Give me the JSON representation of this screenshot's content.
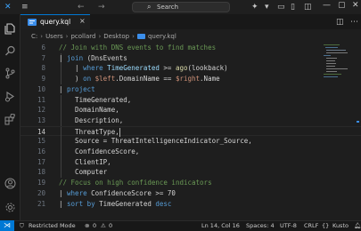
{
  "titlebar": {
    "search_label": "Search",
    "colors": {
      "accent": "#0078d4"
    }
  },
  "tab": {
    "name": "query.kql",
    "close": "×"
  },
  "breadcrumb": [
    "C:",
    "Users",
    "pcollard",
    "Desktop",
    "query.kql"
  ],
  "editor": {
    "current_line": 14,
    "lines": [
      {
        "n": "6",
        "tokens": [
          {
            "t": "// Join with DNS events to find matches",
            "c": "com"
          }
        ],
        "indent": 0
      },
      {
        "n": "7",
        "tokens": [
          {
            "t": "| ",
            "c": "pl"
          },
          {
            "t": "join",
            "c": "kw"
          },
          {
            "t": " (DnsEvents",
            "c": "pl"
          }
        ],
        "indent": 1
      },
      {
        "n": "8",
        "tokens": [
          {
            "t": "    | ",
            "c": "pl"
          },
          {
            "t": "where",
            "c": "kw"
          },
          {
            "t": " TimeGenerated ",
            "c": "id"
          },
          {
            "t": ">= ",
            "c": "pl"
          },
          {
            "t": "ago",
            "c": "fn"
          },
          {
            "t": "(lookback)",
            "c": "pl"
          }
        ],
        "indent": 1
      },
      {
        "n": "9",
        "tokens": [
          {
            "t": "    ) ",
            "c": "pl"
          },
          {
            "t": "on ",
            "c": "kw"
          },
          {
            "t": "$left",
            "c": "var"
          },
          {
            "t": ".DomainName == ",
            "c": "pl"
          },
          {
            "t": "$right",
            "c": "var"
          },
          {
            "t": ".Name",
            "c": "pl"
          }
        ],
        "indent": 1
      },
      {
        "n": "10",
        "tokens": [
          {
            "t": "| ",
            "c": "pl"
          },
          {
            "t": "project",
            "c": "kw"
          }
        ],
        "indent": 0
      },
      {
        "n": "11",
        "tokens": [
          {
            "t": "    TimeGenerated,",
            "c": "pl"
          }
        ],
        "indent": 1
      },
      {
        "n": "12",
        "tokens": [
          {
            "t": "    DomainName,",
            "c": "pl"
          }
        ],
        "indent": 1
      },
      {
        "n": "13",
        "tokens": [
          {
            "t": "    Description,",
            "c": "pl"
          }
        ],
        "indent": 1
      },
      {
        "n": "14",
        "tokens": [
          {
            "t": "    ThreatType,",
            "c": "pl"
          }
        ],
        "indent": 1
      },
      {
        "n": "15",
        "tokens": [
          {
            "t": "    Source = ThreatIntelligenceIndicator_Source,",
            "c": "pl"
          }
        ],
        "indent": 1
      },
      {
        "n": "16",
        "tokens": [
          {
            "t": "    ConfidenceScore,",
            "c": "pl"
          }
        ],
        "indent": 1
      },
      {
        "n": "17",
        "tokens": [
          {
            "t": "    ClientIP,",
            "c": "pl"
          }
        ],
        "indent": 1
      },
      {
        "n": "18",
        "tokens": [
          {
            "t": "    Computer",
            "c": "pl"
          }
        ],
        "indent": 1
      },
      {
        "n": "19",
        "tokens": [
          {
            "t": "// Focus on high confidence indicators",
            "c": "com"
          }
        ],
        "indent": 0
      },
      {
        "n": "20",
        "tokens": [
          {
            "t": "| ",
            "c": "pl"
          },
          {
            "t": "where",
            "c": "kw"
          },
          {
            "t": " ConfidenceScore >= ",
            "c": "pl"
          },
          {
            "t": "70",
            "c": "pl"
          }
        ],
        "indent": 0
      },
      {
        "n": "21",
        "tokens": [
          {
            "t": "| ",
            "c": "pl"
          },
          {
            "t": "sort by",
            "c": "kw"
          },
          {
            "t": " TimeGenerated ",
            "c": "pl"
          },
          {
            "t": "desc",
            "c": "kw"
          }
        ],
        "indent": 0
      }
    ]
  },
  "statusbar": {
    "remote_icon": "remote-icon",
    "restricted": "Restricted Mode",
    "errors": "0",
    "warnings": "0",
    "position": "Ln 14, Col 16",
    "spaces": "Spaces: 4",
    "encoding": "UTF-8",
    "eol": "CRLF",
    "braces": "{}",
    "language": "Kusto"
  }
}
